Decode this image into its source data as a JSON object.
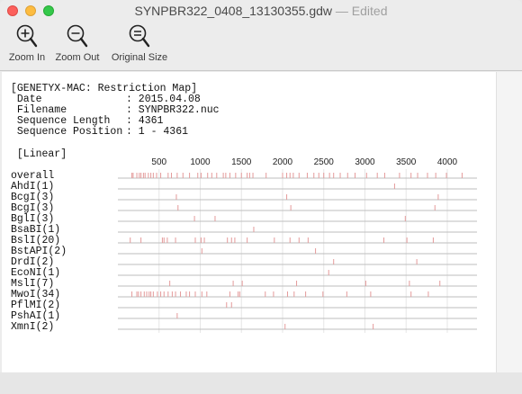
{
  "window": {
    "filename": "SYNPBR322_0408_13130355.gdw",
    "state": "— Edited"
  },
  "toolbar": {
    "zoom_in": "Zoom In",
    "zoom_out": "Zoom Out",
    "original_size": "Original Size"
  },
  "document": {
    "header": "[GENETYX-MAC: Restriction Map]",
    "date_label": " Date",
    "date_value": ": 2015.04.08",
    "filename_label": " Filename",
    "filename_value": ": SYNPBR322.nuc",
    "length_label": " Sequence Length",
    "length_value": ": 4361",
    "position_label": " Sequence Position",
    "position_value": ": 1 - 4361",
    "topology": " [Linear]"
  },
  "map": {
    "sequence_length": 4361,
    "ticks": [
      500,
      1000,
      1500,
      2000,
      2500,
      3000,
      3500,
      4000
    ],
    "site_color": "#e49a9a",
    "rows": [
      {
        "name": "overall",
        "sites": [
          170,
          185,
          230,
          260,
          280,
          310,
          330,
          370,
          400,
          430,
          470,
          520,
          610,
          650,
          720,
          790,
          870,
          970,
          1010,
          1090,
          1140,
          1200,
          1280,
          1310,
          1360,
          1430,
          1500,
          1570,
          1600,
          1640,
          1800,
          2000,
          2050,
          2090,
          2130,
          2200,
          2300,
          2380,
          2440,
          2500,
          2570,
          2620,
          2700,
          2790,
          2880,
          3020,
          3150,
          3240,
          3420,
          3560,
          3640,
          3760,
          3860,
          3990,
          4180
        ]
      },
      {
        "name": "AhdI(1)",
        "sites": [
          3360
        ]
      },
      {
        "name": "BcgI(3)",
        "sites": [
          710,
          2050,
          3890
        ]
      },
      {
        "name": "BcgI(3)",
        "sites": [
          730,
          2100,
          3850
        ]
      },
      {
        "name": "BglI(3)",
        "sites": [
          930,
          1180,
          3490
        ]
      },
      {
        "name": "BsaBI(1)",
        "sites": [
          1650
        ]
      },
      {
        "name": "BslI(20)",
        "sites": [
          150,
          280,
          540,
          560,
          600,
          700,
          940,
          1010,
          1050,
          1330,
          1380,
          1420,
          1570,
          1900,
          2090,
          2200,
          2310,
          3230,
          3510,
          3830
        ]
      },
      {
        "name": "BstAPI(2)",
        "sites": [
          1020,
          2400
        ]
      },
      {
        "name": "DrdI(2)",
        "sites": [
          2620,
          3630
        ]
      },
      {
        "name": "EcoNI(1)",
        "sites": [
          2560
        ]
      },
      {
        "name": "MslI(7)",
        "sites": [
          630,
          1400,
          1510,
          2170,
          3010,
          3540,
          3910
        ]
      },
      {
        "name": "MwoI(34)",
        "sites": [
          170,
          230,
          250,
          280,
          320,
          350,
          380,
          400,
          430,
          480,
          520,
          560,
          610,
          660,
          700,
          760,
          830,
          870,
          940,
          1020,
          1080,
          1360,
          1460,
          1480,
          1790,
          1890,
          2060,
          2140,
          2280,
          2490,
          2780,
          3070,
          3560,
          3770
        ]
      },
      {
        "name": "PflMI(2)",
        "sites": [
          1320,
          1380
        ]
      },
      {
        "name": "PshAI(1)",
        "sites": [
          720
        ]
      },
      {
        "name": "XmnI(2)",
        "sites": [
          2030,
          3100
        ]
      }
    ]
  }
}
